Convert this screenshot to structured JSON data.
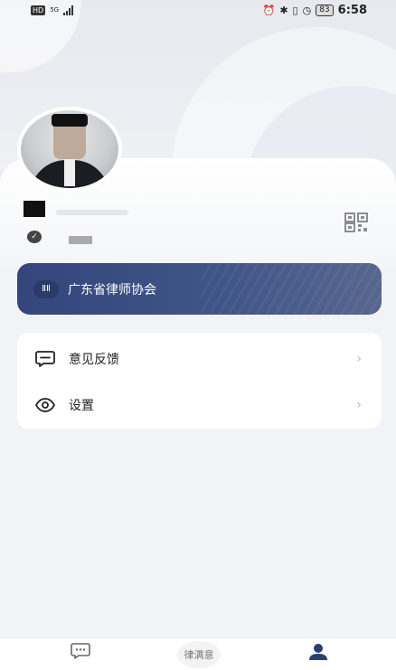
{
  "status_bar": {
    "hd": "HD",
    "network": "5G",
    "battery": "83",
    "time": "6:58"
  },
  "profile": {
    "avatar_alt": "avatar"
  },
  "association": {
    "icon_text": "ⅡⅡ",
    "label": "广东省律师协会"
  },
  "menu": {
    "items": [
      {
        "label": "意见反馈",
        "icon": "feedback-icon"
      },
      {
        "label": "设置",
        "icon": "eye-icon"
      }
    ]
  },
  "tab_bar": {
    "logo_text": "律满意",
    "tabs": [
      "message-icon",
      "logo-icon",
      "profile-icon"
    ],
    "active_tab": "profile-icon"
  },
  "colors": {
    "accent": "#34467c",
    "background": "#f2f3f6",
    "active_icon": "#2b3e73",
    "inactive_icon": "#666666"
  }
}
